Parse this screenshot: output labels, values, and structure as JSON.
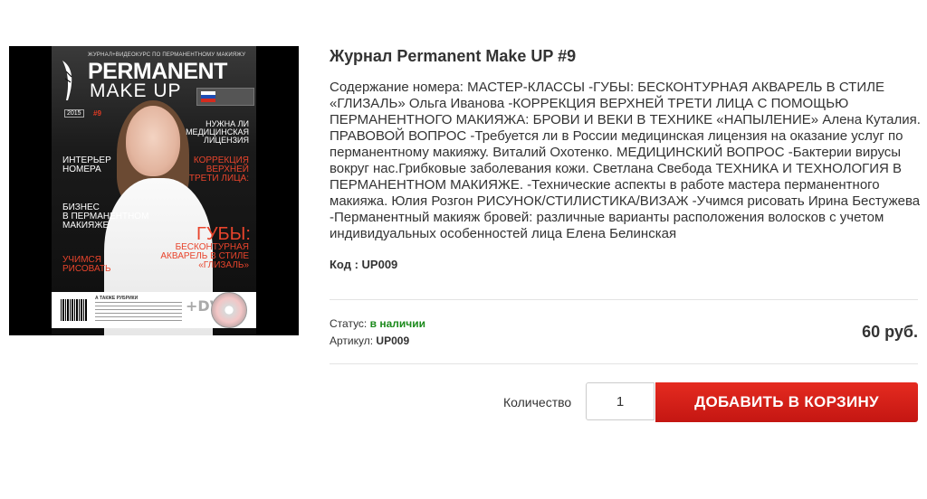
{
  "product": {
    "title": "Журнал Permanent Make UP #9",
    "description": "Содержание номера: МАСТЕР-КЛАССЫ -ГУБЫ: БЕСКОНТУРНАЯ АКВАРЕЛЬ В СТИЛЕ «ГЛИЗАЛЬ» Ольга Иванова -КОРРЕКЦИЯ ВЕРХНЕЙ ТРЕТИ ЛИЦА С ПОМОЩЬЮ ПЕРМАНЕНТНОГО МАКИЯЖА: БРОВИ И ВЕКИ В ТЕХНИКЕ «НАПЫЛЕНИЕ» Алена Куталия. ПРАВОВОЙ ВОПРОС -Требуется ли в России медицинская лицензия на оказание услуг по перманентному макияжу. Виталий Охотенко. МЕДИЦИНСКИЙ ВОПРОС -Бактерии вирусы вокруг нас.Грибковые заболевания кожи. Светлана Свебода ТЕХНИКА И ТЕХНОЛОГИЯ В ПЕРМАНЕНТНОМ МАКИЯЖЕ. -Технические аспекты в работе мастера перманентного макияжа. Юлия Розгон РИСУНОК/СТИЛИСТИКА/ВИЗАЖ -Учимся рисовать Ирина Бестужева -Перманентный макияж бровей: различные варианты расположения волосков с учетом индивидуальных особенностей лица Елена Белинская",
    "code_label": "Код :",
    "code_value": "UP009",
    "status_label": "Статус:",
    "status_value": "в наличии",
    "article_label": "Артикул:",
    "article_value": "UP009",
    "price": "60 руб.",
    "quantity_label": "Количество",
    "quantity_value": "1",
    "add_to_cart_label": "ДОБАВИТЬ В КОРЗИНУ"
  },
  "cover": {
    "topline": "ЖУРНАЛ+ВИДЕОКУРС ПО ПЕРМАНЕНТНОМУ МАКИЯЖУ",
    "title": "PERMANENT",
    "subtitle": "MAKE UP",
    "year": "2015",
    "issue": "#9",
    "right_1": "НУЖНА ЛИ\nМЕДИЦИНСКАЯ\nЛИЦЕНЗИЯ",
    "left_1": "ИНТЕРЬЕР\nНОМЕРА",
    "right_2": "КОРРЕКЦИЯ\nВЕРХНЕЙ\nТРЕТИ ЛИЦА:",
    "left_2": "БИЗНЕС\nВ ПЕРМАНЕНТНОМ\nМАКИЯЖЕ",
    "right_3": "ГУБЫ:",
    "right_4": "БЕСКОНТУРНАЯ\nАКВАРЕЛЬ В СТИЛЕ\n«ГЛИЗАЛЬ»",
    "left_3": "УЧИМСЯ\nРИСОВАТЬ",
    "rubriki": "А ТАКЖЕ РУБРИКИ",
    "dvd": "+DVD"
  },
  "colors": {
    "accent_red": "#d8211a",
    "status_green": "#1b8a1b",
    "text": "#333333",
    "divider": "#e3e3e3"
  }
}
